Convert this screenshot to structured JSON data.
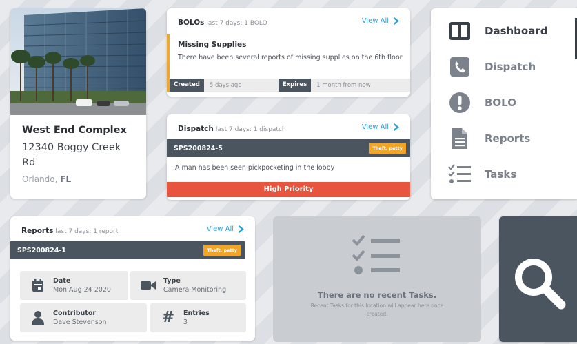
{
  "location": {
    "name": "West End Complex",
    "address": "12340 Boggy Creek Rd",
    "city": "Orlando,",
    "state": "FL"
  },
  "bolos": {
    "title": "BOLOs",
    "subtitle": "last 7 days: 1 BOLO",
    "view_all": "View All",
    "item": {
      "title": "Missing Supplies",
      "text": "There have been several reports of missing supplies on the 6th floor",
      "created_label": "Created",
      "created_value": "5 days ago",
      "expires_label": "Expires",
      "expires_value": "1 month from now",
      "accent_color": "#f0a82c"
    }
  },
  "dispatch": {
    "title": "Dispatch",
    "subtitle": "last 7 days: 1 dispatch",
    "view_all": "View All",
    "item": {
      "id": "SPS200824-5",
      "tag": "Theft, petty",
      "text": "A man has been seen pickpocketing in the lobby",
      "priority": "High Priority",
      "priority_color": "#e8553f"
    }
  },
  "nav": {
    "items": [
      {
        "label": "Dashboard",
        "icon": "dashboard-icon"
      },
      {
        "label": "Dispatch",
        "icon": "phone-icon"
      },
      {
        "label": "BOLO",
        "icon": "alert-icon"
      },
      {
        "label": "Reports",
        "icon": "document-icon"
      },
      {
        "label": "Tasks",
        "icon": "checklist-icon"
      }
    ],
    "active": "Dashboard"
  },
  "reports": {
    "title": "Reports",
    "subtitle": "last 7 days: 1 report",
    "view_all": "View All",
    "item": {
      "id": "SPS200824-1",
      "tag": "Theft, petty",
      "date_label": "Date",
      "date_value": "Mon Aug 24 2020",
      "type_label": "Type",
      "type_value": "Camera Monitoring",
      "contributor_label": "Contributor",
      "contributor_value": "Dave Stevenson",
      "entries_label": "Entries",
      "entries_value": "3"
    }
  },
  "tasks": {
    "empty_title": "There are no recent Tasks.",
    "empty_text": "Recent Tasks for this location will appear here once created."
  },
  "colors": {
    "accent": "#2d9fd9",
    "dark": "#4a5560",
    "warning": "#f2a425",
    "danger": "#e8553f"
  }
}
